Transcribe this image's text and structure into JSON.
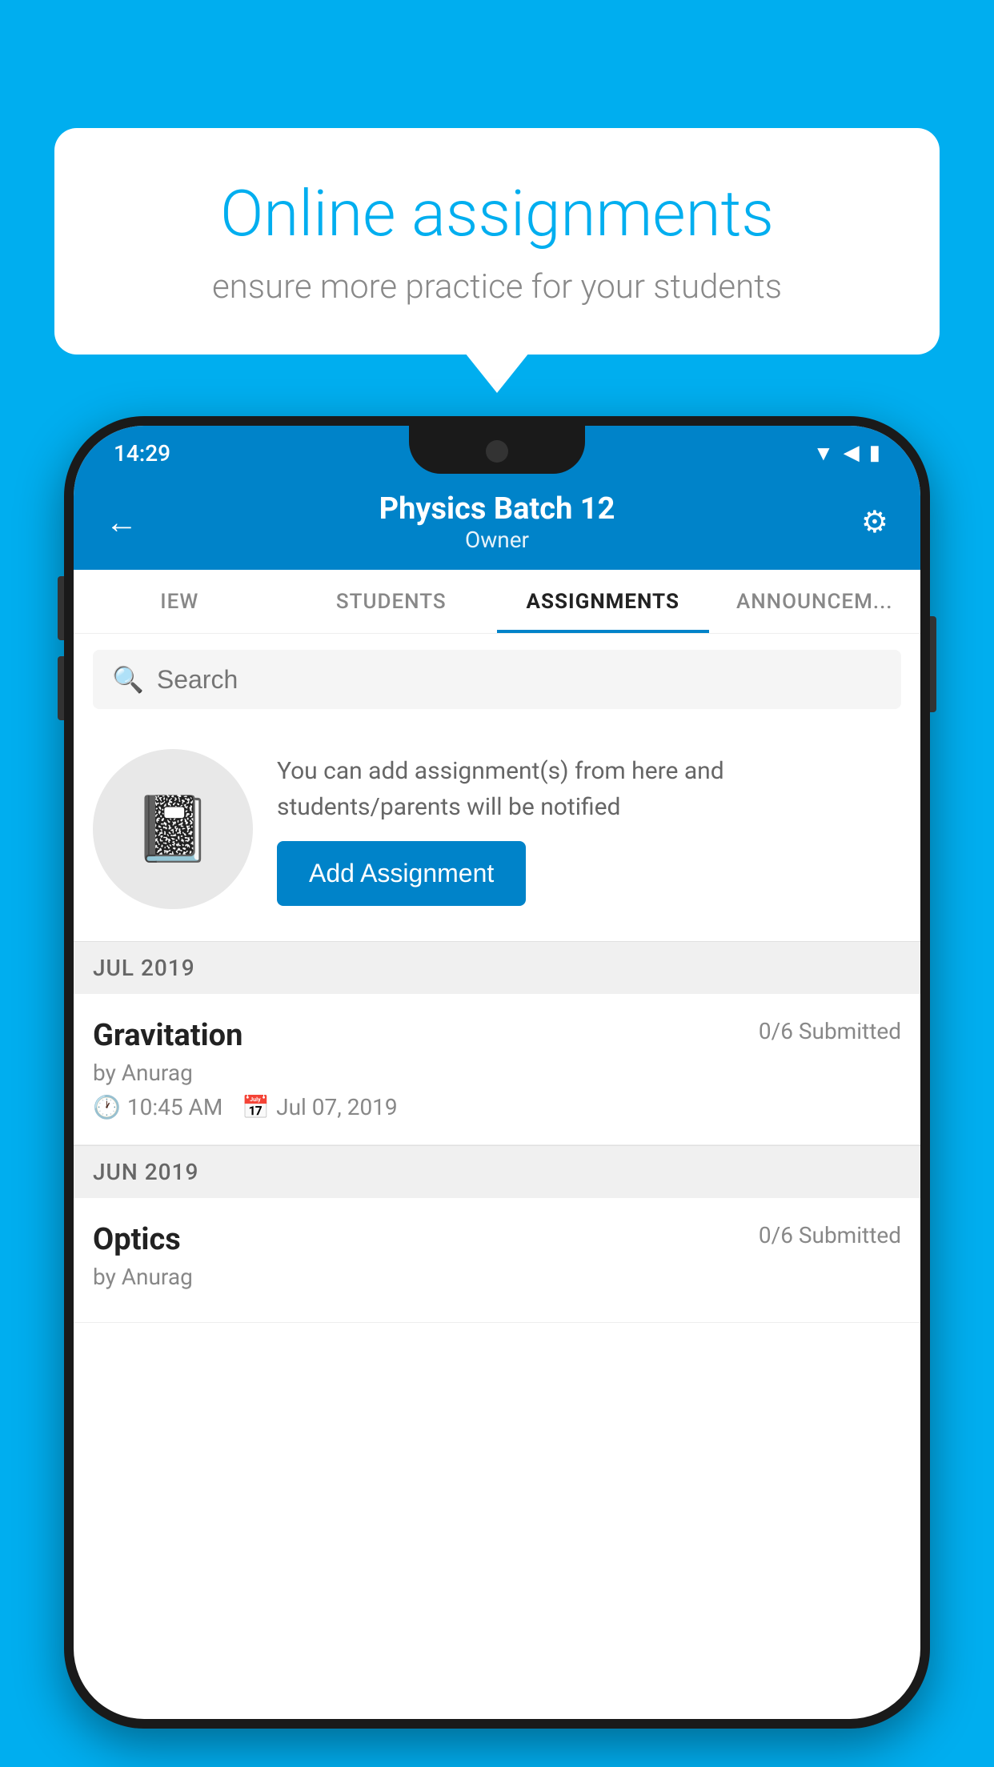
{
  "background_color": "#00AEEF",
  "speech_bubble": {
    "title": "Online assignments",
    "subtitle": "ensure more practice for your students"
  },
  "status_bar": {
    "time": "14:29",
    "wifi_icon": "▼",
    "signal_icon": "◀",
    "battery_icon": "▮"
  },
  "header": {
    "back_icon": "←",
    "title": "Physics Batch 12",
    "subtitle": "Owner",
    "settings_icon": "⚙"
  },
  "tabs": [
    {
      "id": "iew",
      "label": "IEW",
      "active": false
    },
    {
      "id": "students",
      "label": "STUDENTS",
      "active": false
    },
    {
      "id": "assignments",
      "label": "ASSIGNMENTS",
      "active": true
    },
    {
      "id": "announcements",
      "label": "ANNOUNCEM...",
      "active": false
    }
  ],
  "search": {
    "placeholder": "Search",
    "icon": "🔍"
  },
  "empty_state": {
    "icon": "📓",
    "description": "You can add assignment(s) from here and students/parents will be notified",
    "button_label": "Add Assignment"
  },
  "sections": [
    {
      "label": "JUL 2019",
      "assignments": [
        {
          "name": "Gravitation",
          "submitted": "0/6 Submitted",
          "author": "by Anurag",
          "time": "10:45 AM",
          "date": "Jul 07, 2019"
        }
      ]
    },
    {
      "label": "JUN 2019",
      "assignments": [
        {
          "name": "Optics",
          "submitted": "0/6 Submitted",
          "author": "by Anurag",
          "time": "",
          "date": ""
        }
      ]
    }
  ]
}
